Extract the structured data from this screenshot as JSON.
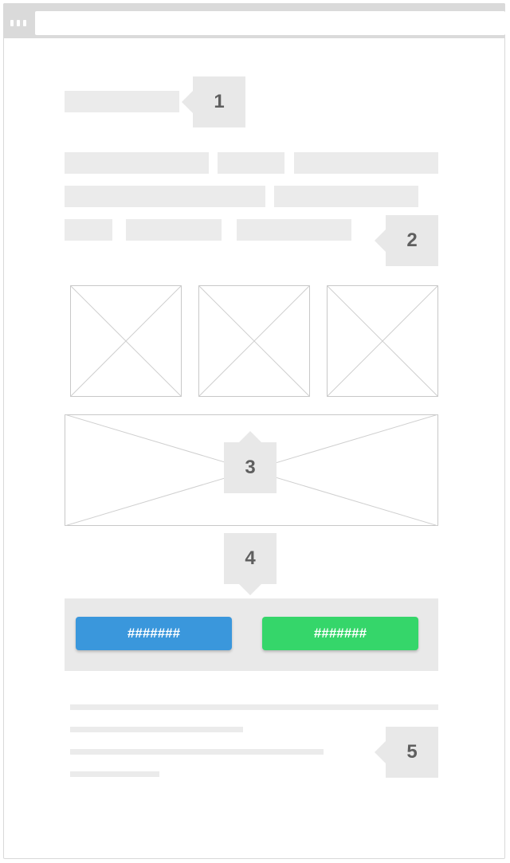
{
  "colors": {
    "primary_button": "#3a97dc",
    "success_button": "#35d66a",
    "placeholder": "#ebebeb",
    "callout": "#e8e8e8",
    "browser_chrome": "#dadada"
  },
  "callouts": [
    "1",
    "2",
    "3",
    "4",
    "5"
  ],
  "buttons": {
    "primary_label": "#######",
    "secondary_label": "#######"
  }
}
